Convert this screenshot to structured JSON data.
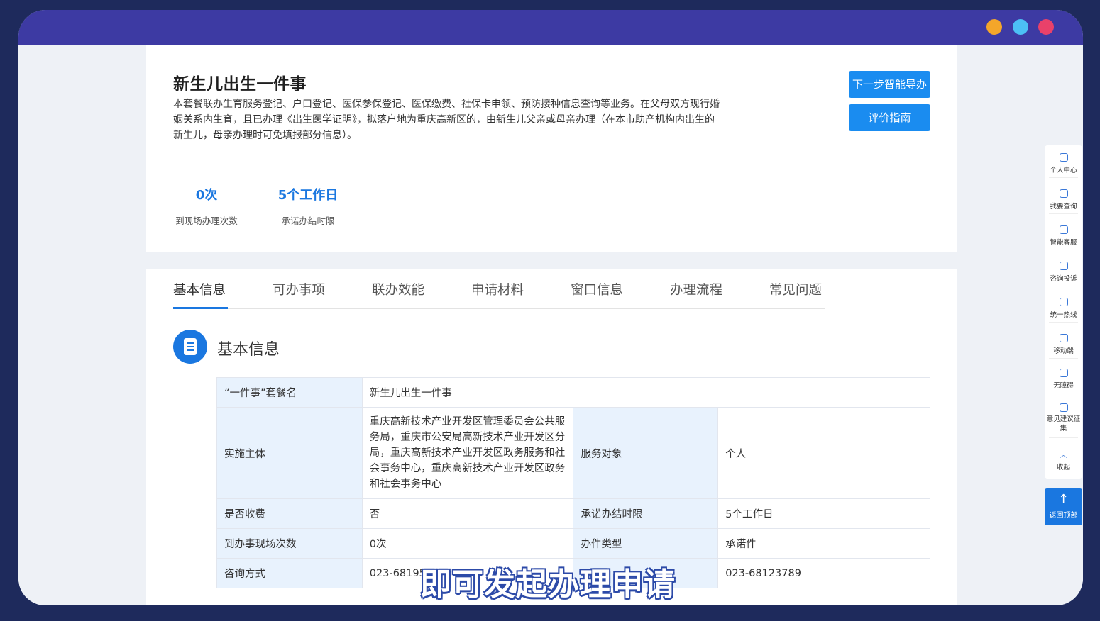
{
  "window": {
    "traffic_lights": [
      "#f4a62a",
      "#4cc0f5",
      "#e9416a"
    ]
  },
  "header_card": {
    "title": "新生儿出生一件事",
    "description": "本套餐联办生育服务登记、户口登记、医保参保登记、医保缴费、社保卡申领、预防接种信息查询等业务。在父母双方现行婚姻关系内生育，且已办理《出生医学证明》，拟落户地为重庆高新区的，由新生儿父亲或母亲办理（在本市助产机构内出生的新生儿，母亲办理时可免填报部分信息）。",
    "btn_guide": "下一步智能导办",
    "btn_eval": "评价指南",
    "stats": [
      {
        "value": "0次",
        "label": "到现场办理次数"
      },
      {
        "value": "5个工作日",
        "label": "承诺办结时限"
      }
    ]
  },
  "tabs": [
    "基本信息",
    "可办事项",
    "联办效能",
    "申请材料",
    "窗口信息",
    "办理流程",
    "常见问题"
  ],
  "active_tab": "基本信息",
  "section": {
    "title": "基本信息"
  },
  "info_table": {
    "package_name_label": "“一件事”套餐名",
    "package_name_value": "新生儿出生一件事",
    "impl_label": "实施主体",
    "impl_value": "重庆高新技术产业开发区管理委员会公共服务局，重庆市公安局高新技术产业开发区分局，重庆高新技术产业开发区政务服务和社会事务中心，重庆高新技术产业开发区政务和社会事务中心",
    "target_label": "服务对象",
    "target_value": "个人",
    "fee_label": "是否收费",
    "fee_value": "否",
    "deadline_label": "承诺办结时限",
    "deadline_value": "5个工作日",
    "visits_label": "到办事现场次数",
    "visits_value": "0次",
    "type_label": "办件类型",
    "type_value": "承诺件",
    "contact_label": "咨询方式",
    "contact_value": "023-68195",
    "phone_value": "023-68123789"
  },
  "side_rail": {
    "items": [
      {
        "label": "个人中心",
        "icon": "user-icon"
      },
      {
        "label": "我要查询",
        "icon": "search-list-icon"
      },
      {
        "label": "智能客服",
        "icon": "service-icon"
      },
      {
        "label": "咨询投诉",
        "icon": "edit-icon"
      },
      {
        "label": "统一热线",
        "icon": "phone-icon"
      },
      {
        "label": "移动端",
        "icon": "mobile-icon"
      },
      {
        "label": "无障碍",
        "icon": "accessibility-icon"
      },
      {
        "label": "意见建议征集",
        "icon": "feedback-icon"
      },
      {
        "label": "收起",
        "icon": "chevron-up-icon"
      }
    ],
    "back_top": "返回顶部"
  },
  "subtitle_overlay": "即可发起办理申请"
}
